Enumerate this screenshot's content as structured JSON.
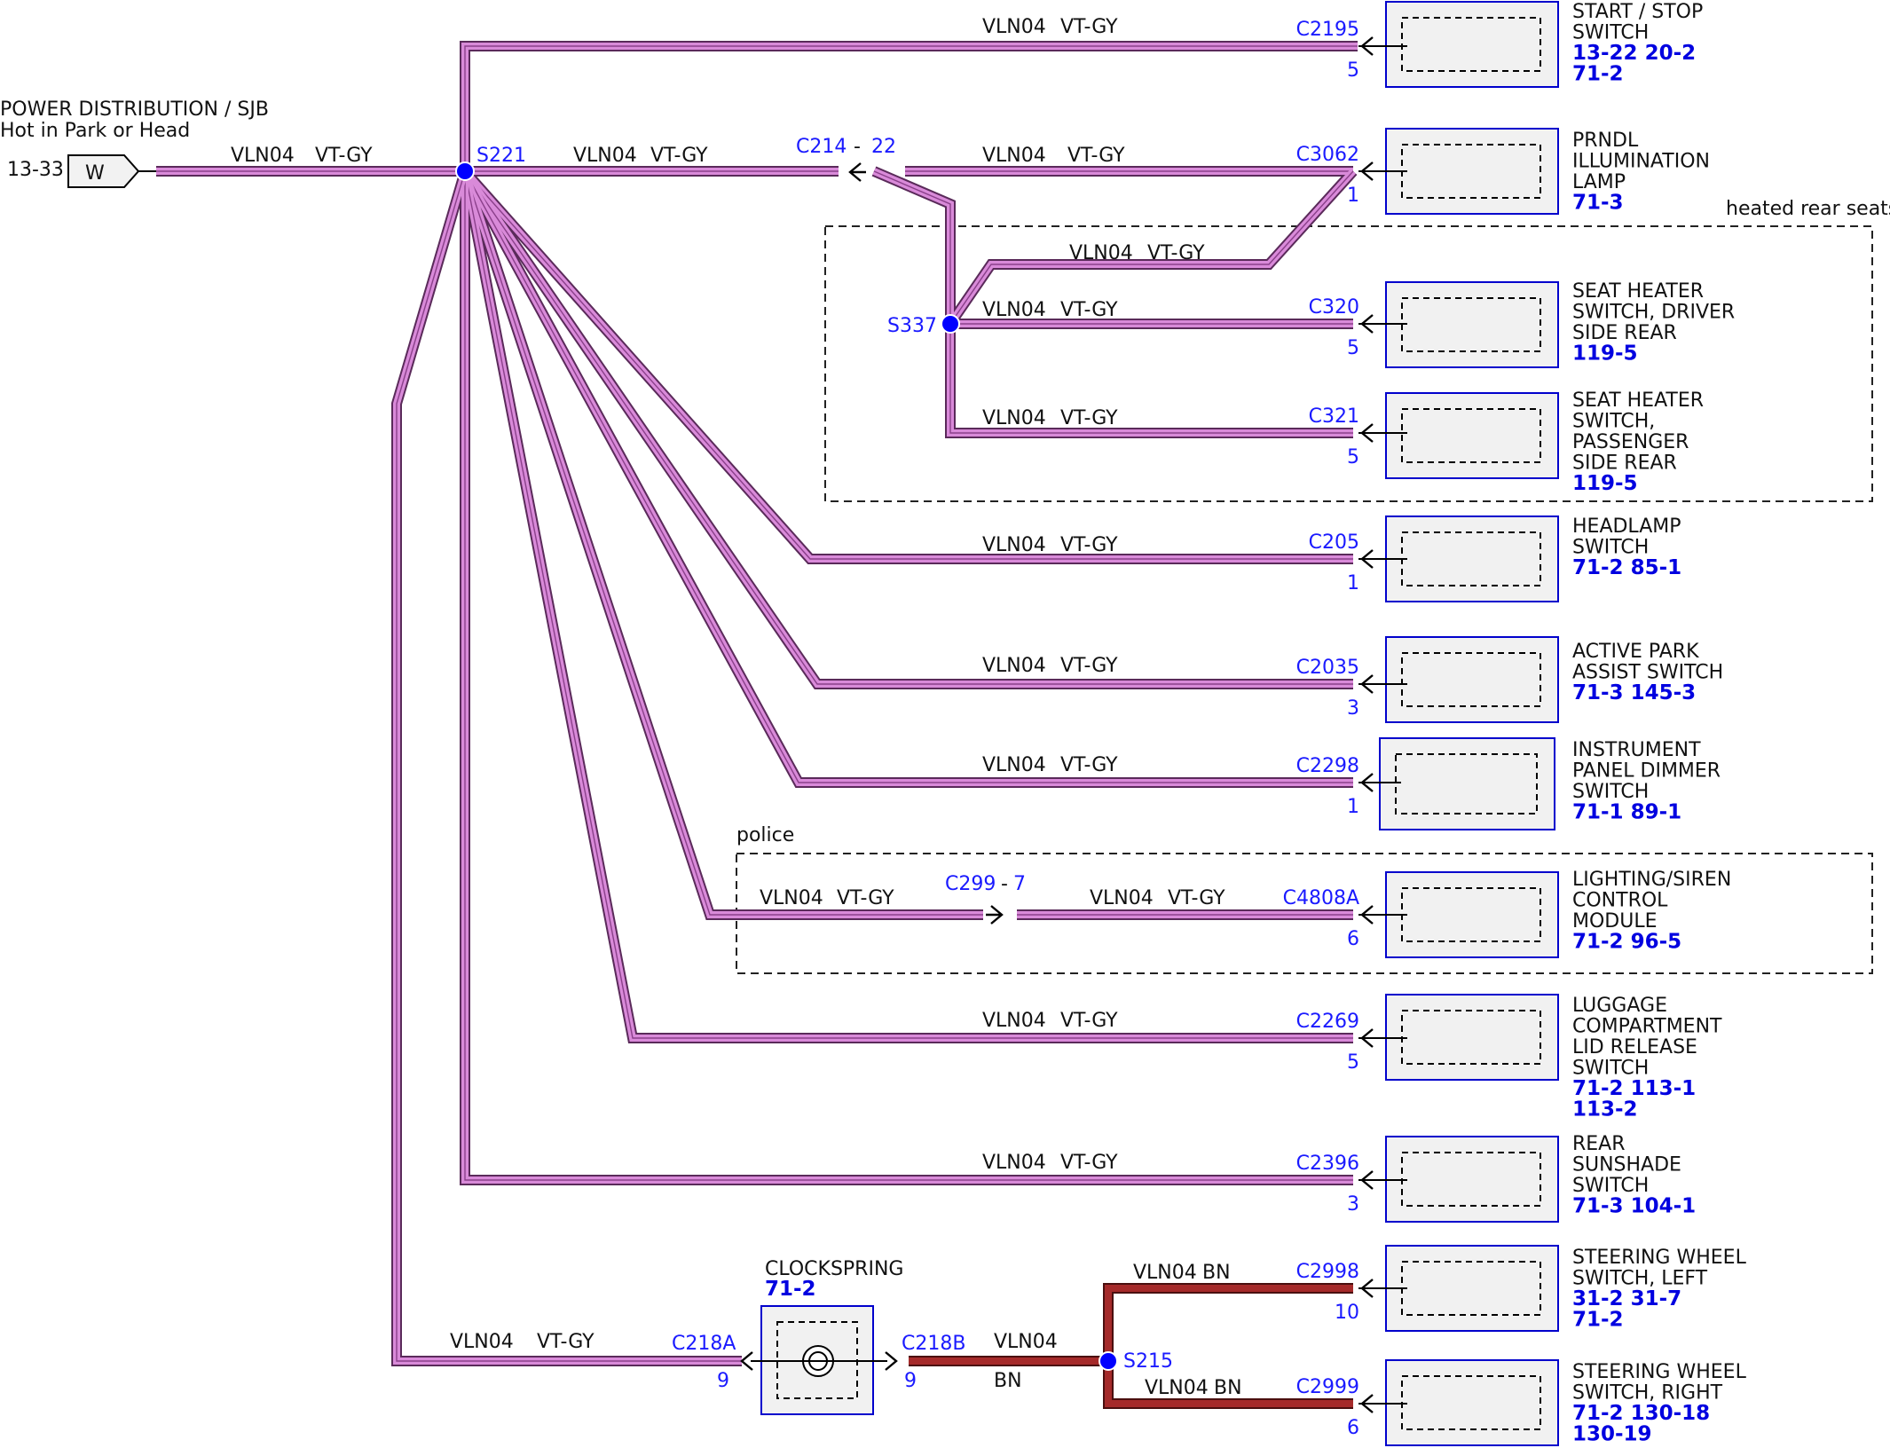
{
  "colors": {
    "wire_vt_gy": "#d98ad9",
    "wire_bn": "#a52a2a",
    "connector_text": "#1a1aff",
    "ref_text": "#0000e0",
    "box_border": "#0000cc",
    "splice": "#0000ff"
  },
  "source": {
    "title": "POWER DISTRIBUTION / SJB",
    "subtitle": "Hot in Park or Head",
    "pin": "13-33",
    "connector": "W"
  },
  "splices": {
    "s221": "S221",
    "s337": "S337",
    "s215": "S215"
  },
  "wire_labels": {
    "circuit": "VLN04",
    "color_vtgy": "VT-GY",
    "color_bn": "BN"
  },
  "groups": {
    "heated_rear_seats": "heated rear seats",
    "police": "police"
  },
  "inline_connectors": {
    "c214": "C214",
    "c214_pin": "22",
    "c299": "C299",
    "c299_pin": "7",
    "dash": "-"
  },
  "devices": [
    {
      "connector": "C2195",
      "pin": "5",
      "name": [
        "START / STOP",
        "SWITCH"
      ],
      "refs": [
        "13-22 20-2",
        "71-2"
      ]
    },
    {
      "connector": "C3062",
      "pin": "1",
      "name": [
        "PRNDL",
        "ILLUMINATION",
        "LAMP"
      ],
      "refs": [
        "71-3"
      ]
    },
    {
      "connector": "C320",
      "pin": "5",
      "name": [
        "SEAT HEATER",
        "SWITCH, DRIVER",
        "SIDE REAR"
      ],
      "refs": [
        "119-5"
      ]
    },
    {
      "connector": "C321",
      "pin": "5",
      "name": [
        "SEAT HEATER",
        "SWITCH,",
        "PASSENGER",
        "SIDE REAR"
      ],
      "refs": [
        "119-5"
      ]
    },
    {
      "connector": "C205",
      "pin": "1",
      "name": [
        "HEADLAMP",
        "SWITCH"
      ],
      "refs": [
        "71-2  85-1"
      ]
    },
    {
      "connector": "C2035",
      "pin": "3",
      "name": [
        "ACTIVE PARK",
        "ASSIST SWITCH"
      ],
      "refs": [
        "71-3  145-3"
      ]
    },
    {
      "connector": "C2298",
      "pin": "1",
      "name": [
        "INSTRUMENT",
        "PANEL DIMMER",
        "SWITCH"
      ],
      "refs": [
        "71-1  89-1"
      ]
    },
    {
      "connector": "C4808A",
      "pin": "6",
      "name": [
        "LIGHTING/SIREN",
        "CONTROL",
        "MODULE"
      ],
      "refs": [
        "71-2  96-5"
      ]
    },
    {
      "connector": "C2269",
      "pin": "5",
      "name": [
        "LUGGAGE",
        "COMPARTMENT",
        "LID RELEASE",
        "SWITCH"
      ],
      "refs": [
        "71-2  113-1",
        "113-2"
      ]
    },
    {
      "connector": "C2396",
      "pin": "3",
      "name": [
        "REAR",
        "SUNSHADE",
        "SWITCH"
      ],
      "refs": [
        "71-3  104-1"
      ]
    },
    {
      "connector": "C2998",
      "pin": "10",
      "name": [
        "STEERING WHEEL",
        "SWITCH, LEFT"
      ],
      "refs": [
        "31-2  31-7",
        "71-2"
      ]
    },
    {
      "connector": "C2999",
      "pin": "6",
      "name": [
        "STEERING WHEEL",
        "SWITCH, RIGHT"
      ],
      "refs": [
        "71-2   130-18",
        "130-19"
      ]
    }
  ],
  "clockspring": {
    "name": "CLOCKSPRING",
    "ref": "71-2",
    "in_connector": "C218A",
    "in_pin": "9",
    "out_connector": "C218B",
    "out_pin": "9"
  }
}
